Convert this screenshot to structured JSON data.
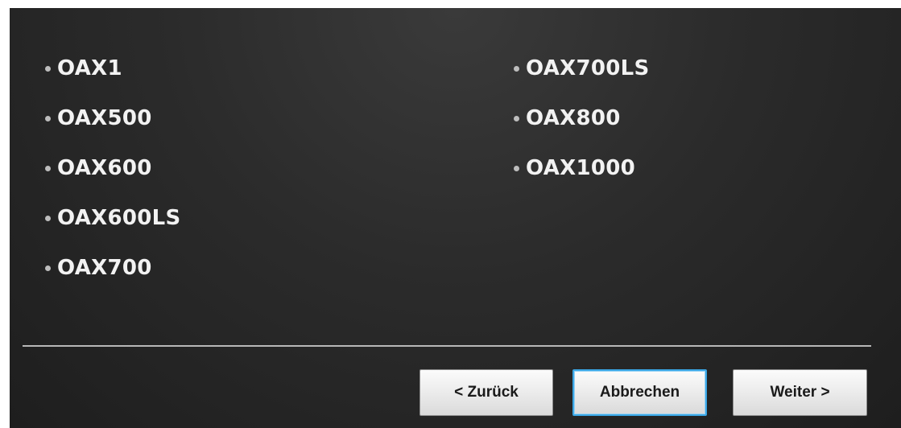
{
  "models": {
    "left": [
      "OAX1",
      "OAX500",
      "OAX600",
      "OAX600LS",
      "OAX700"
    ],
    "right": [
      "OAX700LS",
      "OAX800",
      "OAX1000"
    ]
  },
  "buttons": {
    "back_label": "< Zurück",
    "cancel_label": "Abbrechen",
    "next_label": "Weiter >"
  },
  "colors": {
    "background": "#2b2b2b",
    "text": "#f2f2f2",
    "focus_border": "#3ba7e6"
  }
}
